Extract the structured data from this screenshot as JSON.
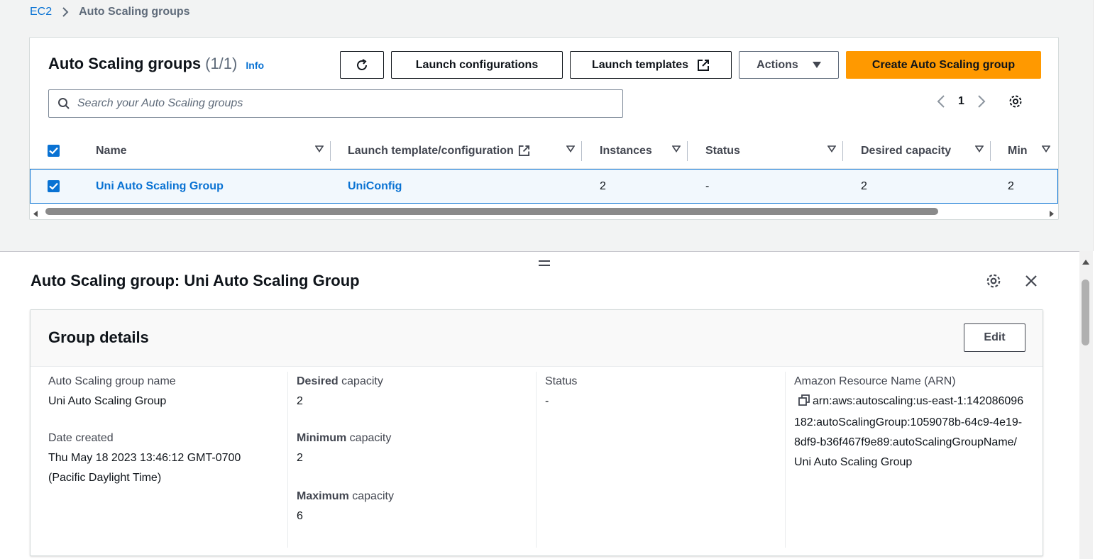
{
  "breadcrumb": {
    "root": "EC2",
    "current": "Auto Scaling groups"
  },
  "groups_table": {
    "title": "Auto Scaling groups",
    "count": "(1/1)",
    "info_label": "Info",
    "buttons": {
      "launch_configurations": "Launch configurations",
      "launch_templates": "Launch templates",
      "actions": "Actions",
      "create": "Create Auto Scaling group"
    },
    "search_placeholder": "Search your Auto Scaling groups",
    "page_number": "1",
    "columns": [
      "Name",
      "Launch template/configuration",
      "Instances",
      "Status",
      "Desired capacity",
      "Min"
    ],
    "rows": [
      {
        "name": "Uni Auto Scaling Group",
        "launch_config": "UniConfig",
        "instances": "2",
        "status": "-",
        "desired": "2",
        "min": "2",
        "selected": true
      }
    ]
  },
  "split_panel": {
    "title": "Auto Scaling group: Uni Auto Scaling Group",
    "group_details": {
      "title": "Group details",
      "edit_label": "Edit",
      "name_label": "Auto Scaling group name",
      "name_value": "Uni Auto Scaling Group",
      "date_label": "Date created",
      "date_value": "Thu May 18 2023 13:46:12 GMT-0700 (Pacific Daylight Time)",
      "desired_bold": "Desired",
      "minimum_bold": "Minimum",
      "maximum_bold": "Maximum",
      "capacity_suffix": " capacity",
      "desired_value": "2",
      "minimum_value": "2",
      "maximum_value": "6",
      "status_label": "Status",
      "status_value": "-",
      "arn_label": "Amazon Resource Name (ARN)",
      "arn_value": "arn:aws:autoscaling:us-east-1:142086096182:autoScalingGroup:1059078b-64c9-4e19-8df9-b36f467f9e89:autoScalingGroupName/Uni Auto Scaling Group"
    }
  },
  "colors": {
    "link": "#0972d3",
    "primary": "#ff9900",
    "text": "#0f141a",
    "muted": "#5f6b7a"
  }
}
